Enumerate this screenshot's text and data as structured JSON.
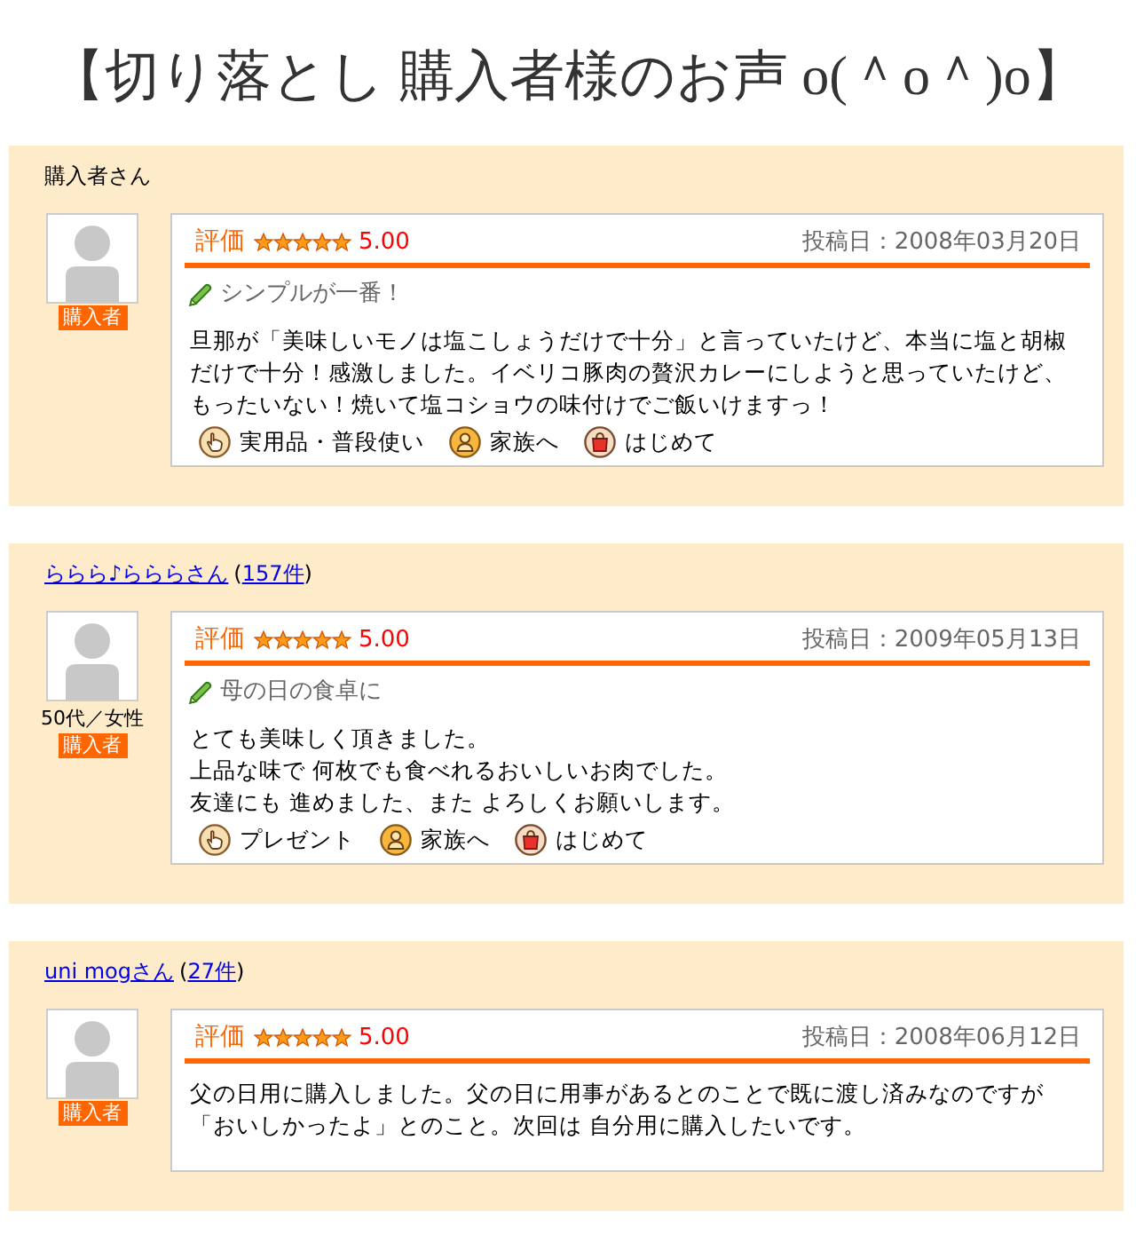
{
  "title": "【切り落とし 購入者様のお声 o(＾o＾)o】",
  "reviews": [
    {
      "reviewer": {
        "name": "購入者さん",
        "linked": false
      },
      "badge": "購入者",
      "rating_label": "評価",
      "stars": 5,
      "score": "5.00",
      "date": "投稿日：2008年03月20日",
      "headline": "シンプルが一番！",
      "body": [
        "旦那が「美味しいモノは塩こしょうだけで十分」と言っていたけど、本当に塩と胡椒だけで十分！感激しました。イベリコ豚肉の贅沢カレーにしようと思っていたけど、もったいない！焼いて塩コショウの味付けでご飯いけますっ！"
      ],
      "tags": [
        {
          "kind": "purpose",
          "label": "実用品・普段使い"
        },
        {
          "kind": "recipient",
          "label": "家族へ"
        },
        {
          "kind": "frequency",
          "label": "はじめて"
        }
      ]
    },
    {
      "reviewer": {
        "name": "ららら♪らららさん",
        "linked": true,
        "count": {
          "before": "(",
          "link": "157件",
          "after": ")"
        }
      },
      "profile": "50代／女性",
      "badge": "購入者",
      "rating_label": "評価",
      "stars": 5,
      "score": "5.00",
      "date": "投稿日：2009年05月13日",
      "headline": "母の日の食卓に",
      "body": [
        "とても美味しく頂きました。",
        "上品な味で 何枚でも食べれるおいしいお肉でした。",
        "友達にも 進めました、また よろしくお願いします。"
      ],
      "tags": [
        {
          "kind": "purpose",
          "label": "プレゼント"
        },
        {
          "kind": "recipient",
          "label": "家族へ"
        },
        {
          "kind": "frequency",
          "label": "はじめて"
        }
      ]
    },
    {
      "reviewer": {
        "name": "uni mogさん",
        "linked": true,
        "count": {
          "before": "(",
          "link": "27件",
          "after": ")"
        }
      },
      "badge": "購入者",
      "rating_label": "評価",
      "stars": 5,
      "score": "5.00",
      "date": "投稿日：2008年06月12日",
      "body": [
        "父の日用に購入しました。父の日に用事があるとのことで既に渡し済みなのですが「おいしかったよ」とのこと。次回は 自分用に購入したいです。"
      ]
    }
  ]
}
